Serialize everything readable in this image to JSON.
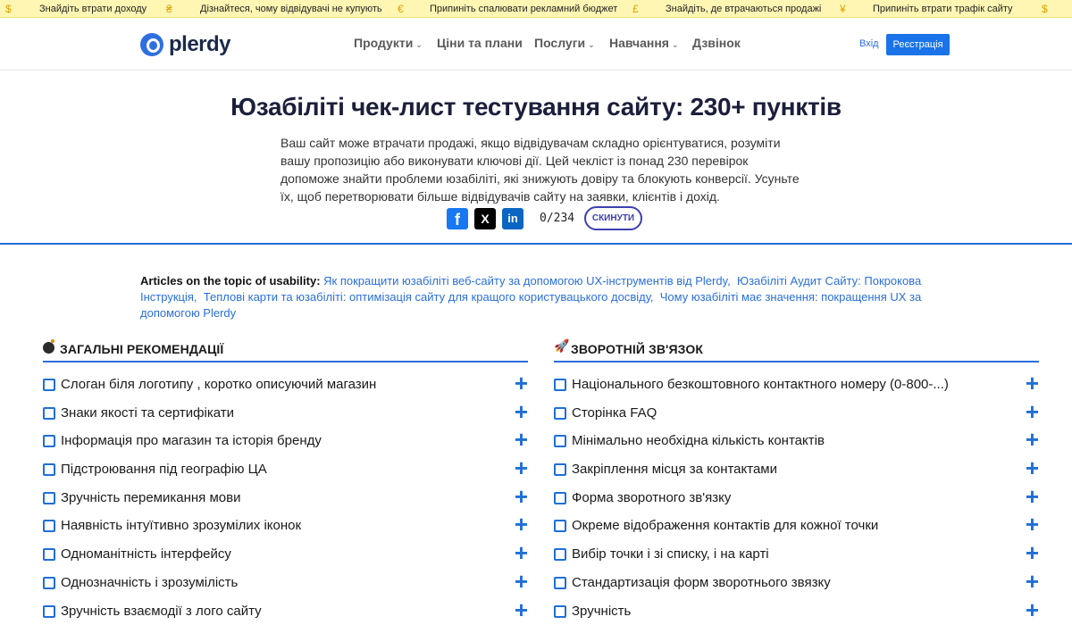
{
  "ticker": [
    {
      "symbol": "$",
      "text": "Знайдіть втрати доходу"
    },
    {
      "symbol": "₴",
      "text": "Дізнайтеся, чому відвідувачі не купують"
    },
    {
      "symbol": "€",
      "text": "Припиніть спалювати рекламний бюджет"
    },
    {
      "symbol": "£",
      "text": "Знайдіть, де втрачаються продажі"
    },
    {
      "symbol": "¥",
      "text": "Припиніть втрати трафік сайту"
    },
    {
      "symbol": "$",
      "text": ""
    }
  ],
  "header": {
    "logo": "plerdy",
    "nav": [
      "Продукти",
      "Ціни та плани",
      "Послуги",
      "Навчання",
      "Дзвінок"
    ],
    "login": "Вхід",
    "register": "Реєстрація"
  },
  "hero": {
    "title": "Юзабіліті чек-лист тестування сайту: 230+ пунктів",
    "description": "Ваш сайт може втрачати продажі, якщо відвідувачам складно орієнтуватися, розуміти вашу пропозицію або виконувати ключові дії. Цей чекліст із понад 230 перевірок допоможе знайти проблеми юзабіліті, які знижують довіру та блокують конверсії. Усуньте їх, щоб перетворювати більше відвідувачів сайту на заявки, клієнтів і дохід.",
    "counter": "0/234",
    "reset": "СКИНУТИ",
    "share": {
      "facebook": "f",
      "x": "X",
      "linkedin": "in"
    }
  },
  "articles": {
    "lead": "Articles on the topic of usability:",
    "links": [
      "Як покращити юзабіліті веб-сайту за допомогою UX-інструментів від Plerdy,",
      "Юзабіліті Аудит Сайту: Покрокова Інструкція,",
      "Теплові карти та юзабіліті: оптимізація сайту для кращого користувацького досвіду,",
      "Чому юзабіліті має значення: покращення UX за допомогою Plerdy"
    ]
  },
  "sections": {
    "left": {
      "title": "ЗАГАЛЬНІ РЕКОМЕНДАЦІЇ",
      "items": [
        "Слоган біля логотипу , коротко описуючий магазин",
        "Знаки якості та сертифікати",
        "Інформація про магазин та історія бренду",
        "Підстроювання під географію ЦА",
        "Зручність перемикання мови",
        "Наявність інтуїтивно зрозумілих іконок",
        "Одноманітність інтерфейсу",
        "Однозначність і зрозумілість",
        "Зручність взаємодії з лого сайту"
      ]
    },
    "right": {
      "title": "ЗВОРОТНІЙ ЗВ'ЯЗОК",
      "items": [
        "Національного безкоштовного контактного номеру (0-800-...)",
        "Сторінка FAQ",
        "Мінімально необхідна кількість контактів",
        "Закріплення місця за контактами",
        "Форма зворотного зв'язку",
        "Окреме відображення контактів для кожної точки",
        "Вибір точки і зі списку, і на карті",
        "Стандартизація форм зворотнього звязку",
        "Зручність"
      ]
    }
  },
  "colors": {
    "accent": "#1f6fd6",
    "register_bg": "#1a73e8",
    "ticker_bg": "#fff6b3",
    "title": "#1b1f3b"
  }
}
